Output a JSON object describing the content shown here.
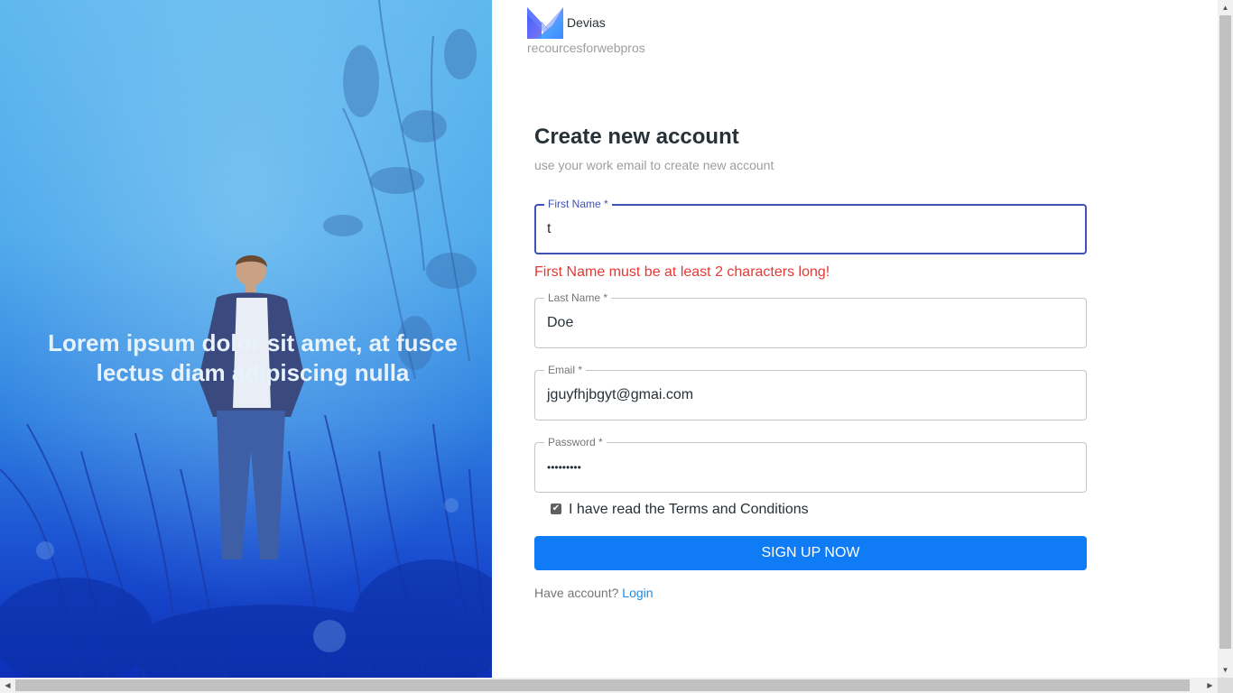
{
  "brand": {
    "name": "Devias",
    "tagline": "recourcesforwebpros"
  },
  "hero": {
    "quote": "Lorem ipsum dolor sit amet, at fusce lectus diam adipiscing nulla"
  },
  "form": {
    "title": "Create new account",
    "subtitle": "use your work email to create new account",
    "fields": [
      {
        "label": "First Name *",
        "value": "t",
        "focused": true
      },
      {
        "label": "Last Name *",
        "value": "Doe"
      },
      {
        "label": "Email *",
        "value": "jguyfhjbgyt@gmai.com"
      },
      {
        "label": "Password *",
        "value": "•••••••••"
      }
    ],
    "error": "First Name must be at least 2 characters long!",
    "terms": {
      "label": "I have read the Terms and Conditions",
      "checked": true
    },
    "submit_label": "SIGN UP NOW",
    "have_account": "Have account?",
    "login_label": "Login"
  },
  "colors": {
    "primary": "#0f7cf5",
    "focus": "#3f51b5",
    "error": "#e53935",
    "link": "#1e88e5"
  }
}
